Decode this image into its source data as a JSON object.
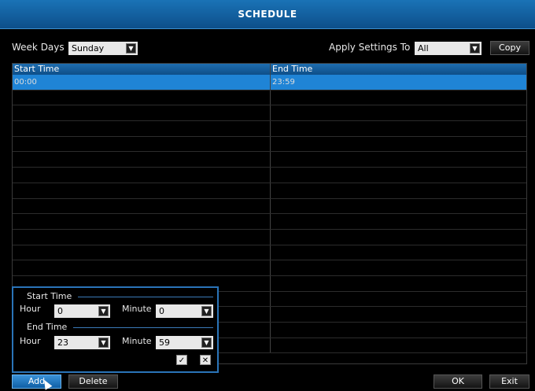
{
  "window": {
    "title": "SCHEDULE"
  },
  "weekdays": {
    "label": "Week Days",
    "value": "Sunday"
  },
  "apply": {
    "label": "Apply Settings To",
    "value": "All",
    "copy_label": "Copy"
  },
  "table": {
    "headers": [
      "Start Time",
      "End Time"
    ],
    "rows": [
      {
        "start": "00:00",
        "end": "23:59"
      }
    ]
  },
  "editor": {
    "start_section": "Start Time",
    "end_section": "End Time",
    "hour_label": "Hour",
    "minute_label": "Minute",
    "start_hour": "0",
    "start_minute": "0",
    "end_hour": "23",
    "end_minute": "59",
    "confirm_glyph": "✓",
    "cancel_glyph": "✕"
  },
  "footer": {
    "add_label": "Add",
    "delete_label": "Delete",
    "ok_label": "OK",
    "exit_label": "Exit"
  },
  "icons": {
    "dropdown": "▼"
  },
  "colors": {
    "accent": "#1f84d6",
    "title_bar": "#1a73b6",
    "background": "#000000"
  }
}
